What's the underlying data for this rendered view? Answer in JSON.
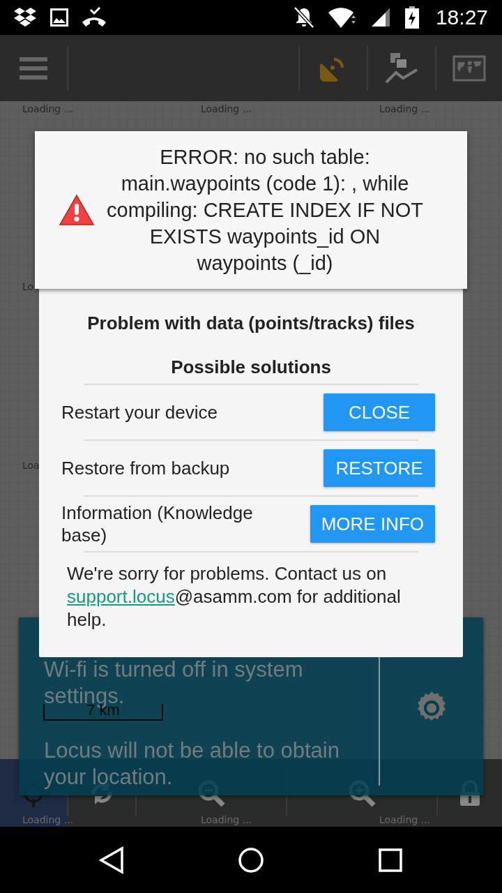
{
  "status_bar": {
    "time": "18:27"
  },
  "map": {
    "tile_labels": [
      "Loading ...",
      "Loading ...",
      "Loading ...",
      "Lo",
      "Loa",
      "Loading ...",
      "Loading ...",
      "Loading ..."
    ]
  },
  "bottom_toolbar": {
    "tools": [
      {
        "kind": "gps",
        "selected": true
      },
      {
        "kind": "rotate",
        "selected": false
      },
      {
        "kind": "zoom-out",
        "selected": false
      },
      {
        "kind": "zoom-in",
        "selected": false
      },
      {
        "kind": "lock",
        "selected": false
      }
    ]
  },
  "wifi_notice": {
    "map_scale": "7 km",
    "lines": [
      "Wi-fi is turned off in system settings.",
      "Locus will not be able to obtain your location."
    ]
  },
  "dialog": {
    "title": "Problem with data (points/tracks) files",
    "subtitle": "Possible solutions",
    "solutions": [
      {
        "text": "Restart your device",
        "button": "CLOSE"
      },
      {
        "text": "Restore from backup",
        "button": "RESTORE"
      },
      {
        "text": "Information (Knowledge base)",
        "button": "MORE INFO"
      }
    ],
    "footer": {
      "before": "We're sorry for problems. Contact us on ",
      "link": "support.locus",
      "after": "@asamm.com for additional help."
    }
  },
  "error_toast": {
    "message": "ERROR: no such table: main.waypoints (code 1): , while compiling: CREATE INDEX IF NOT EXISTS waypoints_id ON waypoints (_id)"
  }
}
